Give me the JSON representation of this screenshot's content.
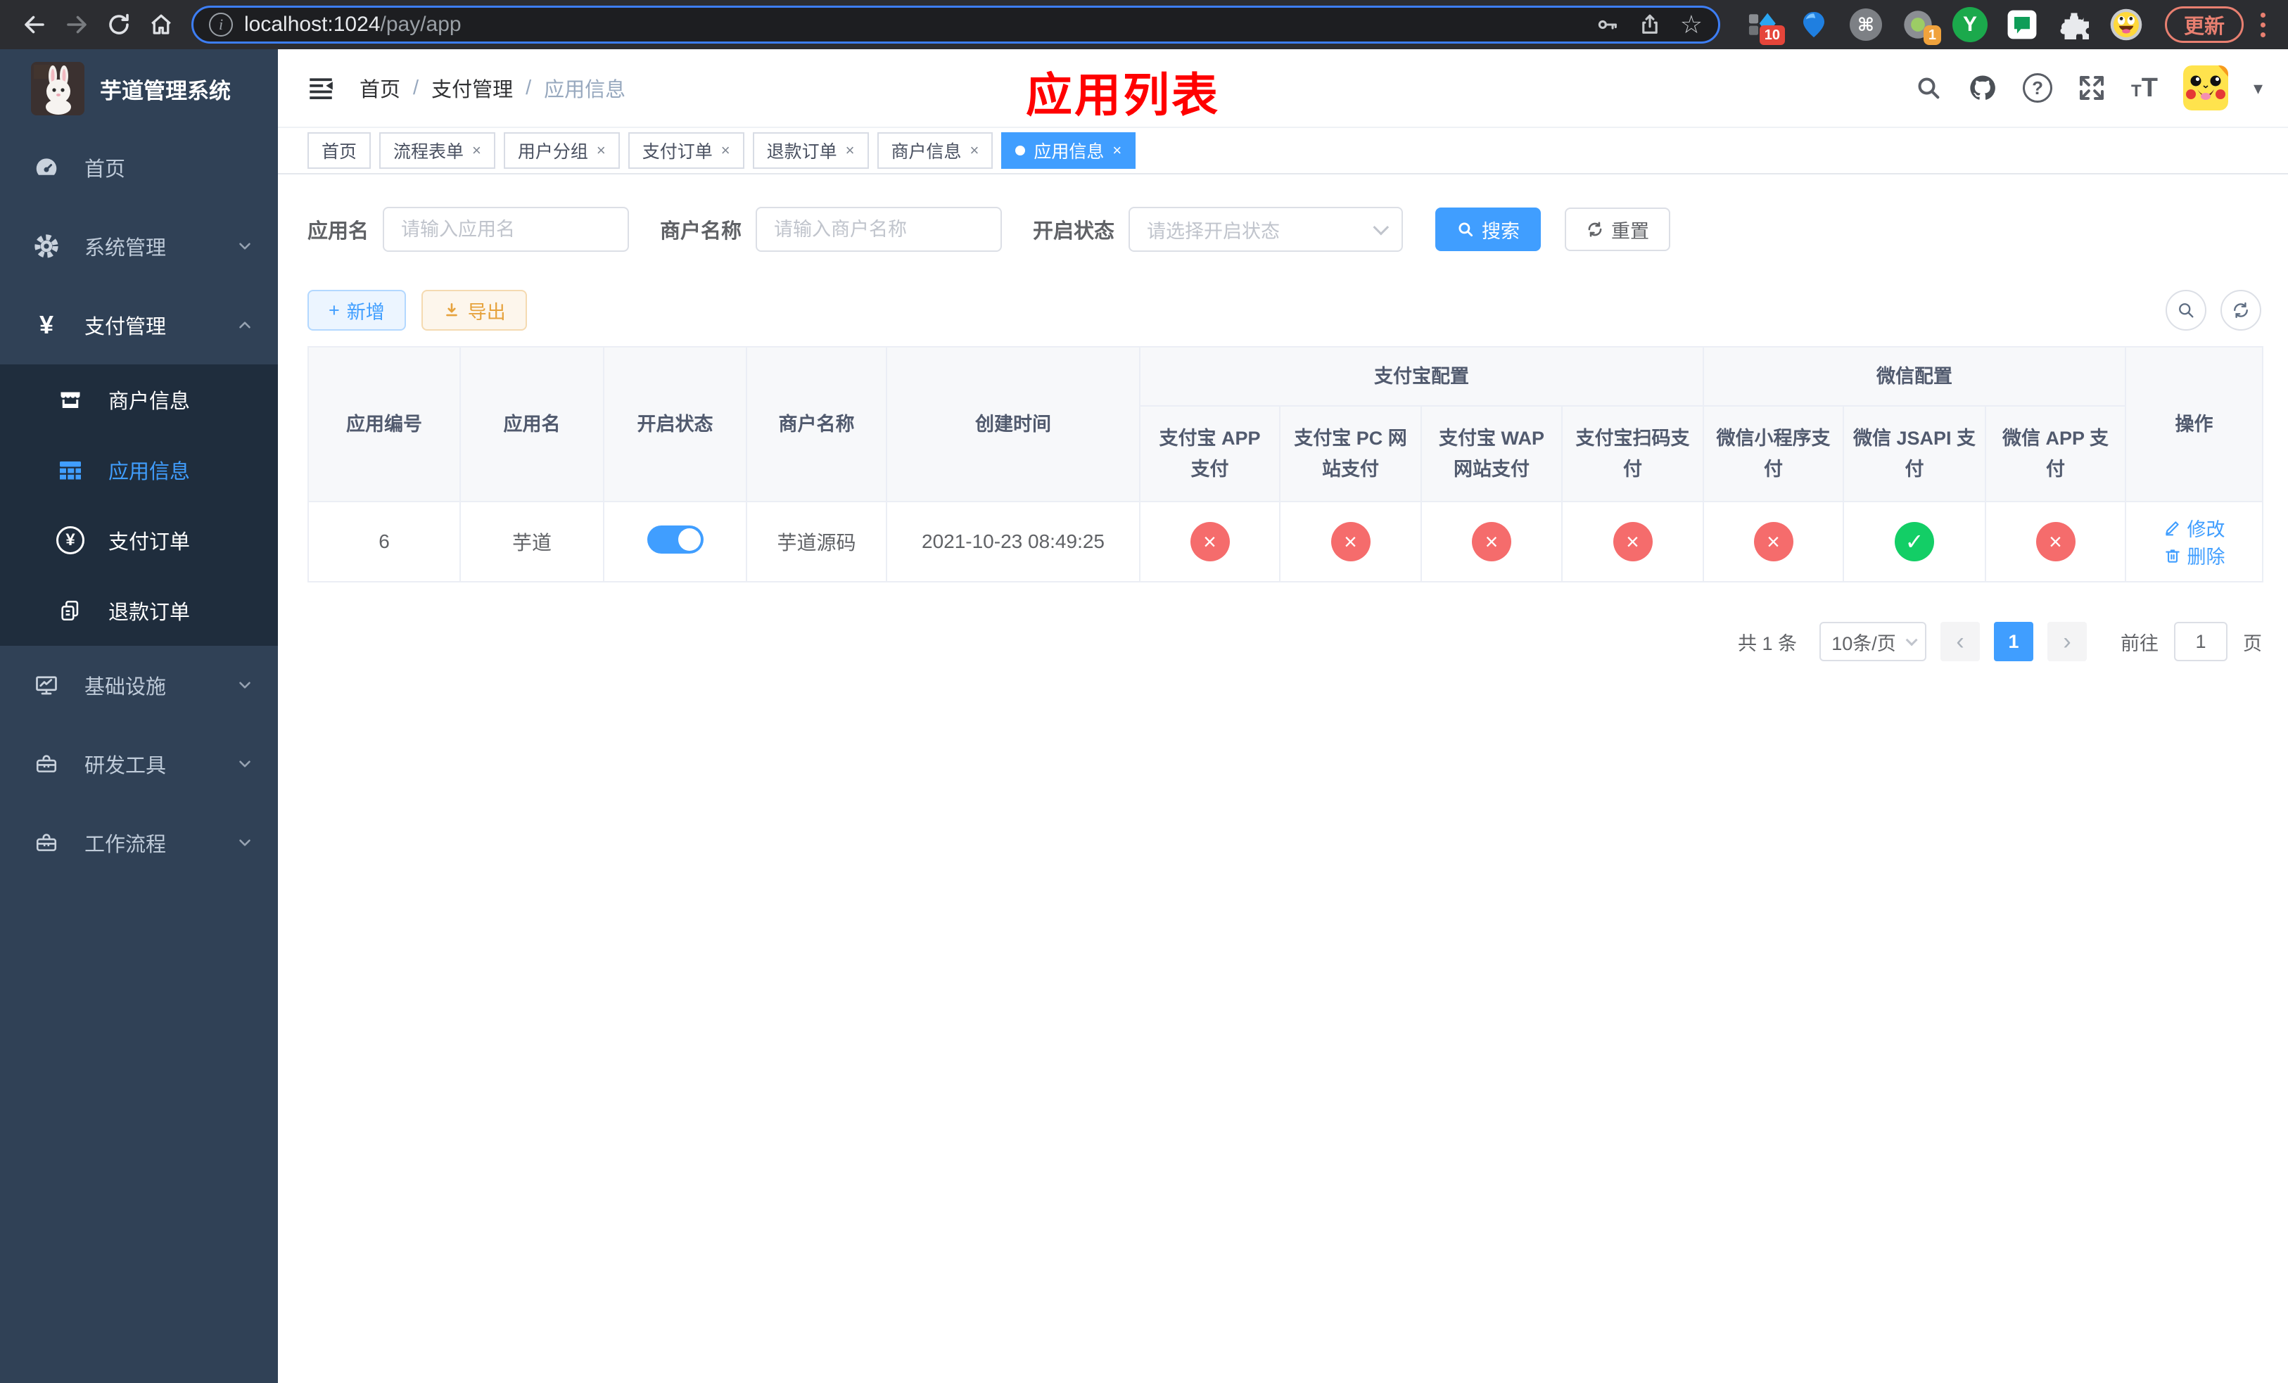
{
  "browser": {
    "url_host": "localhost:1024",
    "url_path": "/pay/app",
    "update_label": "更新",
    "badge_ext1": "10",
    "badge_ext4": "1",
    "ext_y_letter": "Y",
    "cmd_glyph": "⌘",
    "star_glyph": "☆",
    "info_glyph": "i"
  },
  "annotation": {
    "text": "应用列表"
  },
  "sidebar": {
    "title": "芋道管理系统",
    "items": [
      {
        "label": "首页"
      },
      {
        "label": "系统管理"
      },
      {
        "label": "支付管理"
      },
      {
        "label": "商户信息"
      },
      {
        "label": "应用信息"
      },
      {
        "label": "支付订单"
      },
      {
        "label": "退款订单"
      },
      {
        "label": "基础设施"
      },
      {
        "label": "研发工具"
      },
      {
        "label": "工作流程"
      }
    ],
    "yen_glyph": "¥"
  },
  "breadcrumb": {
    "items": [
      "首页",
      "支付管理",
      "应用信息"
    ],
    "sep": "/"
  },
  "header_icons": {
    "question_glyph": "?",
    "font_small": "T",
    "font_big": "T",
    "caret": "▾"
  },
  "tabs": {
    "close_glyph": "×",
    "items": [
      {
        "label": "首页"
      },
      {
        "label": "流程表单"
      },
      {
        "label": "用户分组"
      },
      {
        "label": "支付订单"
      },
      {
        "label": "退款订单"
      },
      {
        "label": "商户信息"
      },
      {
        "label": "应用信息"
      }
    ]
  },
  "filters": {
    "name_label": "应用名",
    "name_placeholder": "请输入应用名",
    "merchant_label": "商户名称",
    "merchant_placeholder": "请输入商户名称",
    "status_label": "开启状态",
    "status_placeholder": "请选择开启状态",
    "search_label": "搜索",
    "reset_label": "重置"
  },
  "toolbar_actions": {
    "add_label": "新增",
    "export_label": "导出",
    "plus_glyph": "+"
  },
  "table": {
    "group_alipay": "支付宝配置",
    "group_wechat": "微信配置",
    "columns": [
      "应用编号",
      "应用名",
      "开启状态",
      "商户名称",
      "创建时间",
      "支付宝 APP 支付",
      "支付宝 PC 网站支付",
      "支付宝 WAP 网站支付",
      "支付宝扫码支付",
      "微信小程序支付",
      "微信 JSAPI 支付",
      "微信 APP 支付",
      "操作"
    ],
    "pass_glyph": "✓",
    "fail_glyph": "×",
    "row": {
      "app_id": "6",
      "app_name": "芋道",
      "enabled": true,
      "merchant_name": "芋道源码",
      "create_time": "2021-10-23 08:49:25",
      "statuses": [
        false,
        false,
        false,
        false,
        false,
        true,
        false
      ],
      "edit_label": "修改",
      "delete_label": "删除"
    }
  },
  "pagination": {
    "total": "共 1 条",
    "page_size": "10条/页",
    "prev_glyph": "‹",
    "next_glyph": "›",
    "page": "1",
    "goto_label": "前往",
    "goto_value": "1",
    "goto_unit": "页"
  }
}
